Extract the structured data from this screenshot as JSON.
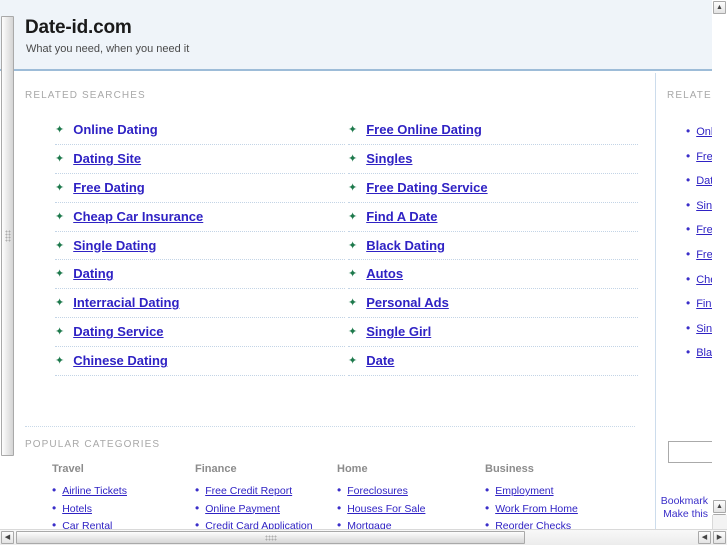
{
  "header": {
    "site_title": "Date-id.com",
    "tagline": "What you need, when you need it",
    "background_color": "#eff4f9",
    "border_color": "#9dbcd8"
  },
  "main": {
    "related_searches_label": "RELATED SEARCHES",
    "link_color": "#2f22c4",
    "bullet_icon": "star-bullet-icon",
    "bullet_color": "#1f7a4d",
    "columns": [
      {
        "items": [
          "Online Dating",
          "Dating Site",
          "Free Dating",
          "Cheap Car Insurance",
          "Single Dating",
          "Dating",
          "Interracial Dating",
          "Dating Service",
          "Chinese Dating"
        ]
      },
      {
        "items": [
          "Free Online Dating",
          "Singles",
          "Free Dating Service",
          "Find A Date",
          "Black Dating",
          "Autos",
          "Personal Ads",
          "Single Girl",
          "Date"
        ]
      }
    ]
  },
  "categories": {
    "label": "POPULAR CATEGORIES",
    "groups": [
      {
        "heading": "Travel",
        "items": [
          "Airline Tickets",
          "Hotels",
          "Car Rental"
        ]
      },
      {
        "heading": "Finance",
        "items": [
          "Free Credit Report",
          "Online Payment",
          "Credit Card Application"
        ]
      },
      {
        "heading": "Home",
        "items": [
          "Foreclosures",
          "Houses For Sale",
          "Mortgage"
        ]
      },
      {
        "heading": "Business",
        "items": [
          "Employment",
          "Work From Home",
          "Reorder Checks"
        ]
      }
    ]
  },
  "sidebar": {
    "label": "RELATED",
    "bullet_icon": "dot-bullet-icon",
    "items": [
      "Online Dating",
      "Free Online Dating",
      "Dating Site",
      "Singles",
      "Free Dating",
      "Free Dating Service",
      "Cheap Car Insurance",
      "Find A Date",
      "Single Dating",
      "Black Dating"
    ],
    "search_value": "",
    "search_placeholder": "",
    "footer_links": [
      "Bookmark",
      "Make this"
    ]
  },
  "scrollbars": {
    "vertical": {
      "up_arrow": "▲",
      "down_arrow": "▼"
    },
    "horizontal": {
      "left_arrow": "◀",
      "right_arrow": "▶"
    }
  }
}
